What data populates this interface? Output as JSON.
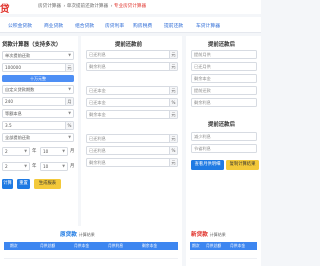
{
  "header": {
    "logo": "贷",
    "breadcrumbs": [
      "房贷计算器",
      "单次提前还款计算器",
      "专业房贷计算器"
    ],
    "breadcrumb_active": "专业房贷计算器"
  },
  "tabs": [
    "公积金贷款",
    "商业贷款",
    "组合贷款",
    "房贷利率",
    "购房税费",
    "提前还款",
    "车贷计算器"
  ],
  "calculator": {
    "title": "贷款计算器（支持多次）",
    "loan_type": "单次提前还款",
    "loan_amount": "100000",
    "amount_unit": "元",
    "add_strip": "十万元整",
    "rate_type": "自定义贷款期数",
    "term_value": "240",
    "term_unit": "月",
    "repay_method": "等额本息",
    "rate_value": "3.5",
    "rate_unit": "%",
    "base_rate": "全部提前还款",
    "year_unit": "年",
    "month_unit": "月",
    "start_year": "2",
    "start_month": "10",
    "end_year": "2",
    "end_month": "10",
    "calc_button": "计算",
    "reset_button": "重置",
    "save_button": "生成报表"
  },
  "before": {
    "title": "提前还款前",
    "fields": [
      {
        "placeholder": "已还利息",
        "unit": "元"
      },
      {
        "placeholder": "剩余利息",
        "unit": "元"
      },
      {
        "placeholder": "已还本金",
        "unit": "元"
      },
      {
        "placeholder": "已还本金",
        "unit": "%"
      },
      {
        "placeholder": "剩余本金",
        "unit": "元"
      },
      {
        "placeholder": "已还利息",
        "unit": "元"
      },
      {
        "placeholder": "已还利息",
        "unit": "%"
      },
      {
        "placeholder": "剩余利息",
        "unit": "元"
      }
    ]
  },
  "after": {
    "title": "提前还款后",
    "fields": [
      "提前月供",
      "已还月供",
      "剩余本金",
      "提前还款",
      "剩余利息"
    ],
    "result_title": "提前还款后",
    "result_fields": [
      "减少利息",
      "节省利息"
    ],
    "btn_a": "查看月供明细",
    "btn_b": "复制计算结果"
  },
  "bottom": {
    "left_title": "原贷款",
    "left_sub": "计算结果",
    "right_title": "新贷款",
    "right_sub": "计算结果",
    "columns": [
      "期次",
      "月供总额",
      "月供本金",
      "月供利息",
      "剩余本金"
    ]
  }
}
